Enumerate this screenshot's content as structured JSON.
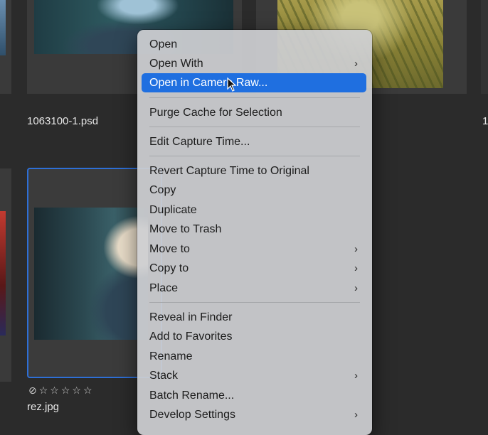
{
  "files": {
    "top_filename": "1063100-1.psd",
    "top_right_partial": "1",
    "selected_filename": "rez.jpg"
  },
  "colors": {
    "accent": "#1f6fe0",
    "selection_border": "#2e6fd6",
    "background": "#2b2b2b"
  },
  "menu": {
    "items": [
      {
        "label": "Open"
      },
      {
        "label": "Open With",
        "submenu": true
      },
      {
        "label": "Open in Camera Raw...",
        "highlighted": true
      },
      {
        "label": "Purge Cache for Selection"
      },
      {
        "label": "Edit Capture Time..."
      },
      {
        "label": "Revert Capture Time to Original"
      },
      {
        "label": "Copy"
      },
      {
        "label": "Duplicate"
      },
      {
        "label": "Move to Trash"
      },
      {
        "label": "Move to",
        "submenu": true
      },
      {
        "label": "Copy to",
        "submenu": true
      },
      {
        "label": "Place",
        "submenu": true
      },
      {
        "label": "Reveal in Finder"
      },
      {
        "label": "Add to Favorites"
      },
      {
        "label": "Rename"
      },
      {
        "label": "Stack",
        "submenu": true
      },
      {
        "label": "Batch Rename..."
      },
      {
        "label": "Develop Settings",
        "submenu": true
      }
    ],
    "chevron": "›"
  },
  "rating": {
    "stars": 0,
    "max": 5,
    "reject_icon": "reject-circle-icon"
  }
}
